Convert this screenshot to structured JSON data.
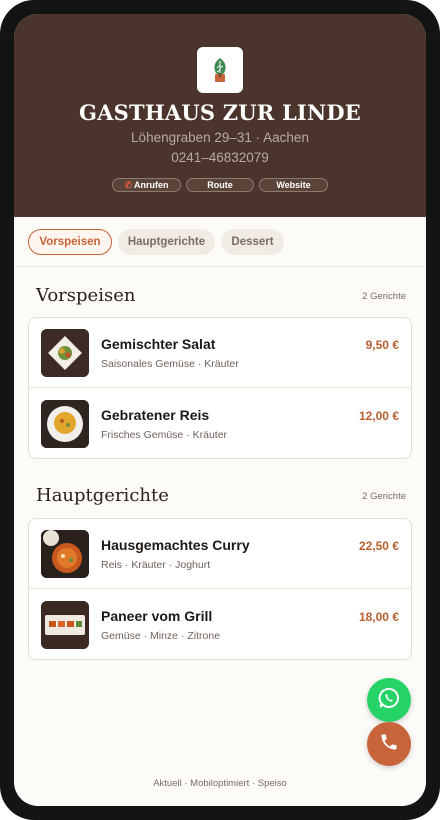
{
  "header": {
    "title": "GASTHAUS ZUR LINDE",
    "address": "Löhengraben 29–31 · Aachen",
    "phone": "0241–46832079",
    "logo_icon": "tree-logo",
    "actions": [
      {
        "label": "Anrufen",
        "icon": "phone-icon"
      },
      {
        "label": "Route"
      },
      {
        "label": "Website"
      }
    ]
  },
  "tabs": [
    {
      "label": "Vorspeisen",
      "active": true
    },
    {
      "label": "Hauptgerichte",
      "active": false
    },
    {
      "label": "Dessert",
      "active": false
    }
  ],
  "sections": [
    {
      "title": "Vorspeisen",
      "count": "2 Gerichte",
      "items": [
        {
          "name": "Gemischter Salat",
          "desc": "Saisonales Gemüse · Kräuter",
          "price": "9,50 €",
          "image": "salad-photo"
        },
        {
          "name": "Gebratener Reis",
          "desc": "Frisches Gemüse · Kräuter",
          "price": "12,00 €",
          "image": "rice-photo"
        }
      ]
    },
    {
      "title": "Hauptgerichte",
      "count": "2 Gerichte",
      "items": [
        {
          "name": "Hausgemachtes Curry",
          "desc": "Reis · Kräuter · Joghurt",
          "price": "22,50 €",
          "image": "curry-photo"
        },
        {
          "name": "Paneer vom Grill",
          "desc": "Gemüse · Minze · Zitrone",
          "price": "18,00 €",
          "image": "paneer-photo"
        }
      ]
    }
  ],
  "fabs": {
    "whatsapp_icon": "whatsapp-icon",
    "call_icon": "phone-icon"
  },
  "footer": "Aktuell · Mobiloptimiert · Speiso",
  "colors": {
    "header_bg": "#4a342b",
    "accent": "#c8643a",
    "whatsapp": "#25d366",
    "page_bg": "#fdfbf7"
  }
}
